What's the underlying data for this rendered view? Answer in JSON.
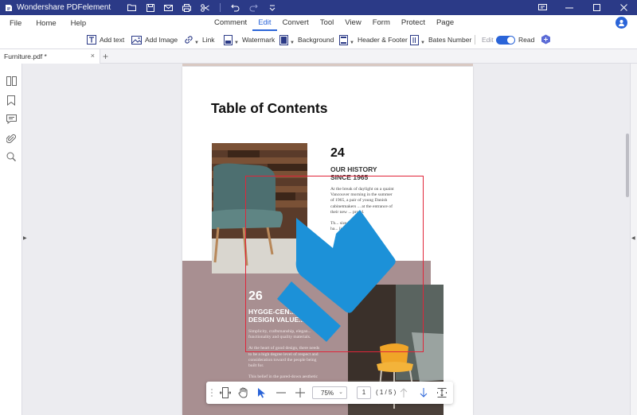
{
  "window": {
    "title": "Wondershare PDFelement"
  },
  "menu": {
    "left_items": [
      "File",
      "Home",
      "Help"
    ],
    "tabs": [
      "Comment",
      "Edit",
      "Convert",
      "Tool",
      "View",
      "Form",
      "Protect",
      "Page"
    ],
    "active_tab": "Edit"
  },
  "toolbar": {
    "add_text": "Add text",
    "add_image": "Add Image",
    "link": "Link",
    "watermark": "Watermark",
    "background": "Background",
    "header_footer": "Header & Footer",
    "bates_number": "Bates Number",
    "edit_mode": "Edit",
    "read_mode": "Read"
  },
  "document_tab": {
    "name": "Furniture.pdf *",
    "close": "×",
    "new_tab": "+"
  },
  "page": {
    "title": "Table of Contents",
    "sections": [
      {
        "number": "24",
        "heading_line1": "OUR HISTORY",
        "heading_line2": "SINCE 1965",
        "body_lines": [
          "At the break of daylight on a quaint",
          "Vancouver morning in the summer",
          "of 1965, a pair of young Danish",
          "cabinetmakers ... at the entrance of",
          "their new ... proud.",
          "",
          "Th... size but it",
          "ha... lingly built"
        ]
      },
      {
        "number": "26",
        "heading_line1": "HYGGE-CEN...",
        "heading_line2": "DESIGN VALUE...",
        "body_lines": [
          "Simplicity, craftsmanship, elegan...",
          "functionality and quality materials.",
          "",
          "At the heart of good design, there needs",
          "to be a high degree level of respect and",
          "consideration toward the people being",
          "built for.",
          "",
          "This belief in the pared-down aesthetic"
        ]
      }
    ]
  },
  "bottom_toolbar": {
    "zoom": "75%",
    "page_input": "1",
    "page_count": "( 1 / 5 )"
  },
  "colors": {
    "titlebar": "#2b3a87",
    "accent": "#2a64d8",
    "selection": "#e0253a",
    "watermark": "#1c91d8",
    "pink_band": "#a88f91"
  }
}
